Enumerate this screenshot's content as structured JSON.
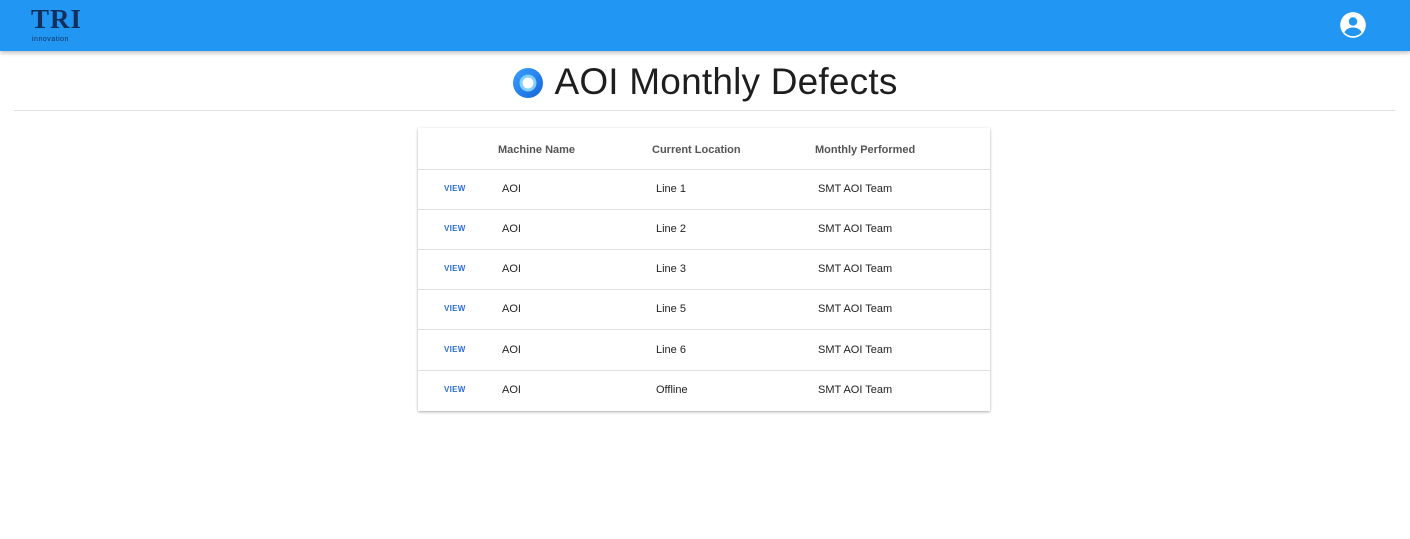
{
  "header": {
    "logo_text": "TRI",
    "logo_subtext": "innovation",
    "account_icon": "account-circle-icon",
    "bar_color": "#2196f3"
  },
  "page": {
    "title": "AOI Monthly Defects",
    "title_icon": "radio-button-checked-icon"
  },
  "table": {
    "columns": [
      "Machine Name",
      "Current Location",
      "Monthly Performed"
    ],
    "rows": [
      {
        "action": "VIEW",
        "machine": "AOI",
        "location": "Line 1",
        "monthly": "SMT AOI Team"
      },
      {
        "action": "VIEW",
        "machine": "AOI",
        "location": "Line 2",
        "monthly": "SMT AOI Team"
      },
      {
        "action": "VIEW",
        "machine": "AOI",
        "location": "Line 3",
        "monthly": "SMT AOI Team"
      },
      {
        "action": "VIEW",
        "machine": "AOI",
        "location": "Line 5",
        "monthly": "SMT AOI Team"
      },
      {
        "action": "VIEW",
        "machine": "AOI",
        "location": "Line 6",
        "monthly": "SMT AOI Team"
      },
      {
        "action": "VIEW",
        "machine": "AOI",
        "location": "Offline",
        "monthly": "SMT AOI Team"
      }
    ]
  }
}
